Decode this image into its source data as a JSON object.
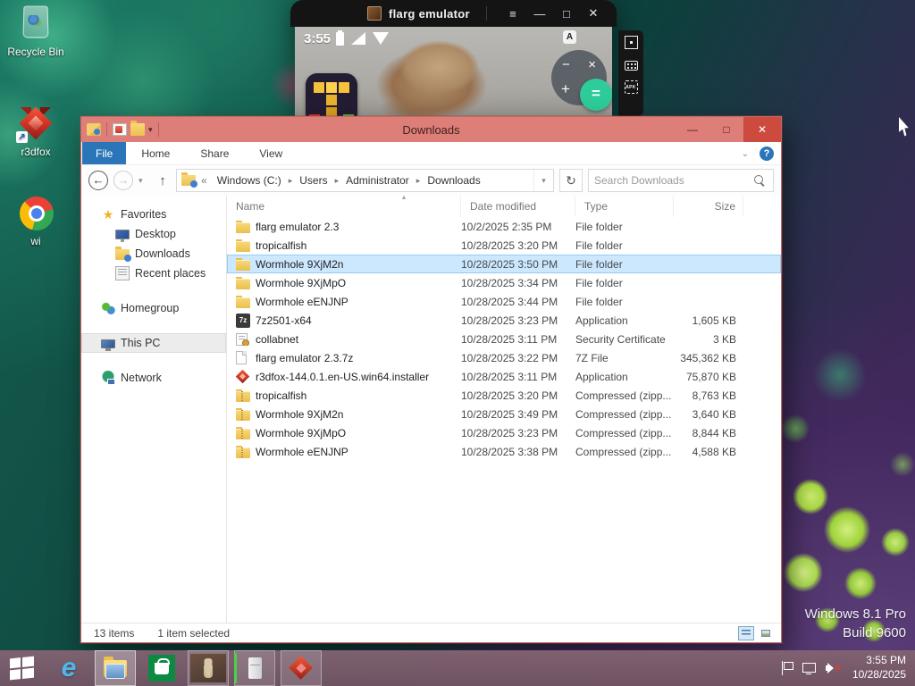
{
  "desktop": {
    "icons": [
      {
        "label": "Recycle Bin",
        "icon": "recycle-bin"
      },
      {
        "label": "r3dfox",
        "icon": "r3dfox-shortcut"
      },
      {
        "label": "wi",
        "icon": "browser"
      }
    ],
    "shortcut_arrow": "↗",
    "watermark": {
      "line1": "Windows 8.1 Pro",
      "line2": "Build 9600"
    }
  },
  "emulator": {
    "title": "flarg emulator",
    "controls": {
      "menu": "≡",
      "minimize": "—",
      "maximize": "□",
      "close": "✕"
    },
    "statusbar": {
      "time": "3:55",
      "badge": "A"
    },
    "widget": {
      "minus": "−",
      "close": "×",
      "plus": "+",
      "equals": "="
    },
    "side_toolbar": {
      "apk_label": "APK"
    }
  },
  "explorer": {
    "title": "Downloads",
    "controls": {
      "minimize": "—",
      "maximize": "□",
      "close": "✕"
    },
    "tabs": [
      {
        "label": "File"
      },
      {
        "label": "Home"
      },
      {
        "label": "Share"
      },
      {
        "label": "View"
      }
    ],
    "ribbon_collapse": "⌄",
    "help": "?",
    "nav": {
      "back": "←",
      "forward": "→",
      "up": "↑",
      "refresh": "↻",
      "dropdown": "▾",
      "overflow": "«",
      "crumb_sep": "▸"
    },
    "breadcrumb": [
      "Windows (C:)",
      "Users",
      "Administrator",
      "Downloads"
    ],
    "search_placeholder": "Search Downloads",
    "sidebar": [
      {
        "label": "Favorites",
        "icon": "star",
        "indent": 0
      },
      {
        "label": "Desktop",
        "icon": "desktop",
        "indent": 1
      },
      {
        "label": "Downloads",
        "icon": "downloads-folder",
        "indent": 1
      },
      {
        "label": "Recent places",
        "icon": "recent",
        "indent": 1
      },
      {
        "label": "Homegroup",
        "icon": "homegroup",
        "indent": 0,
        "gap": true
      },
      {
        "label": "This PC",
        "icon": "this-pc",
        "indent": 0,
        "gap": true,
        "selected": true
      },
      {
        "label": "Network",
        "icon": "network",
        "indent": 0,
        "gap": true
      }
    ],
    "columns": [
      "Name",
      "Date modified",
      "Type",
      "Size"
    ],
    "sort_indicator": "▴",
    "icon_labels": {
      "app-7z": "7z"
    },
    "rows": [
      {
        "icon": "folder",
        "name": "flarg emulator 2.3",
        "date": "10/2/2025 2:35 PM",
        "type": "File folder",
        "size": ""
      },
      {
        "icon": "folder",
        "name": "tropicalfish",
        "date": "10/28/2025 3:20 PM",
        "type": "File folder",
        "size": ""
      },
      {
        "icon": "folder",
        "name": "Wormhole 9XjM2n",
        "date": "10/28/2025 3:50 PM",
        "type": "File folder",
        "size": "",
        "selected": true
      },
      {
        "icon": "folder",
        "name": "Wormhole 9XjMpO",
        "date": "10/28/2025 3:34 PM",
        "type": "File folder",
        "size": ""
      },
      {
        "icon": "folder",
        "name": "Wormhole eENJNP",
        "date": "10/28/2025 3:44 PM",
        "type": "File folder",
        "size": ""
      },
      {
        "icon": "app-7z",
        "name": "7z2501-x64",
        "date": "10/28/2025 3:23 PM",
        "type": "Application",
        "size": "1,605 KB"
      },
      {
        "icon": "certificate",
        "name": "collabnet",
        "date": "10/28/2025 3:11 PM",
        "type": "Security Certificate",
        "size": "3 KB"
      },
      {
        "icon": "file",
        "name": "flarg emulator 2.3.7z",
        "date": "10/28/2025 3:22 PM",
        "type": "7Z File",
        "size": "345,362 KB"
      },
      {
        "icon": "fox",
        "name": "r3dfox-144.0.1.en-US.win64.installer",
        "date": "10/28/2025 3:11 PM",
        "type": "Application",
        "size": "75,870 KB"
      },
      {
        "icon": "zip",
        "name": "tropicalfish",
        "date": "10/28/2025 3:20 PM",
        "type": "Compressed (zipp...",
        "size": "8,763 KB"
      },
      {
        "icon": "zip",
        "name": "Wormhole 9XjM2n",
        "date": "10/28/2025 3:49 PM",
        "type": "Compressed (zipp...",
        "size": "3,640 KB"
      },
      {
        "icon": "zip",
        "name": "Wormhole 9XjMpO",
        "date": "10/28/2025 3:23 PM",
        "type": "Compressed (zipp...",
        "size": "8,844 KB"
      },
      {
        "icon": "zip",
        "name": "Wormhole eENJNP",
        "date": "10/28/2025 3:38 PM",
        "type": "Compressed (zipp...",
        "size": "4,588 KB"
      }
    ],
    "status": {
      "items": "13 items",
      "selected": "1 item selected"
    }
  },
  "taskbar": {
    "tray_time": "3:55 PM",
    "tray_date": "10/28/2025"
  }
}
